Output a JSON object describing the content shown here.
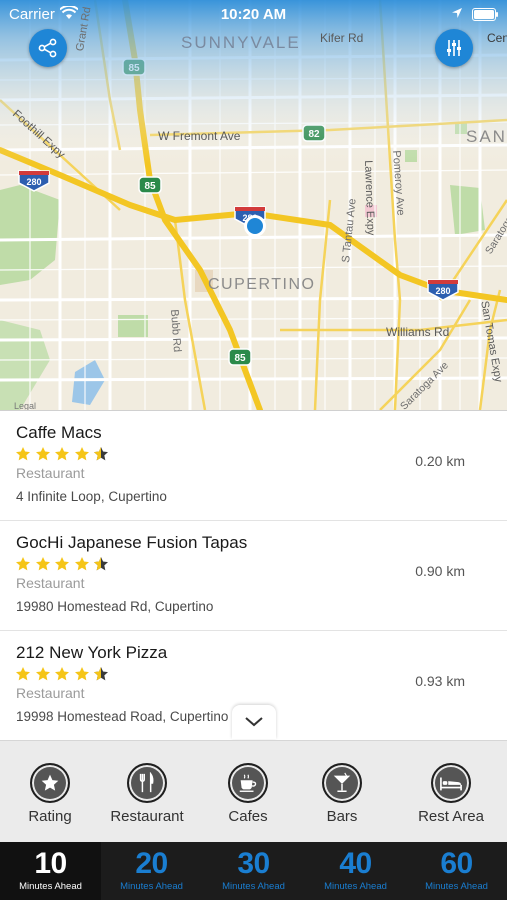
{
  "status_bar": {
    "carrier": "Carrier",
    "time": "10:20 AM"
  },
  "map": {
    "city_labels": [
      "SUNNYVALE",
      "CUPERTINO",
      "SANT"
    ],
    "street_labels": [
      "Grant Rd",
      "Kifer Rd",
      "W Fremont Ave",
      "Foothill Expy",
      "Lawrence Expy",
      "Pomeroy Ave",
      "S Tantau Ave",
      "Bubb Rd",
      "Williams Rd",
      "Saratoga Ave",
      "San Tomas Expy",
      "Saratoga Ave",
      "Cen"
    ],
    "shields": [
      "85",
      "82",
      "85",
      "280",
      "280",
      "85",
      "280"
    ],
    "legal": "Legal"
  },
  "places": [
    {
      "name": "Caffe Macs",
      "rating": 4.5,
      "category": "Restaurant",
      "address": "4 Infinite Loop, Cupertino",
      "distance": "0.20 km"
    },
    {
      "name": "GocHi Japanese Fusion Tapas",
      "rating": 4.5,
      "category": "Restaurant",
      "address": "19980 Homestead Rd, Cupertino",
      "distance": "0.90 km"
    },
    {
      "name": "212 New York Pizza",
      "rating": 4.5,
      "category": "Restaurant",
      "address": "19998 Homestead Road, Cupertino",
      "distance": "0.93 km"
    }
  ],
  "categories": [
    {
      "label": "Rating",
      "icon": "star-icon"
    },
    {
      "label": "Restaurant",
      "icon": "fork-knife-icon"
    },
    {
      "label": "Cafes",
      "icon": "coffee-cup-icon"
    },
    {
      "label": "Bars",
      "icon": "cocktail-glass-icon"
    },
    {
      "label": "Rest Area",
      "icon": "bed-icon"
    }
  ],
  "time_tabs": [
    {
      "value": "10",
      "label": "Minutes Ahead",
      "active": true
    },
    {
      "value": "20",
      "label": "Minutes Ahead",
      "active": false
    },
    {
      "value": "30",
      "label": "Minutes Ahead",
      "active": false
    },
    {
      "value": "40",
      "label": "Minutes Ahead",
      "active": false
    },
    {
      "value": "60",
      "label": "Minutes Ahead",
      "active": false
    }
  ],
  "colors": {
    "accent": "#1f86d6",
    "star": "#f5c518",
    "highway": "#f3c623",
    "timebar_bg": "#1c1c1c"
  }
}
